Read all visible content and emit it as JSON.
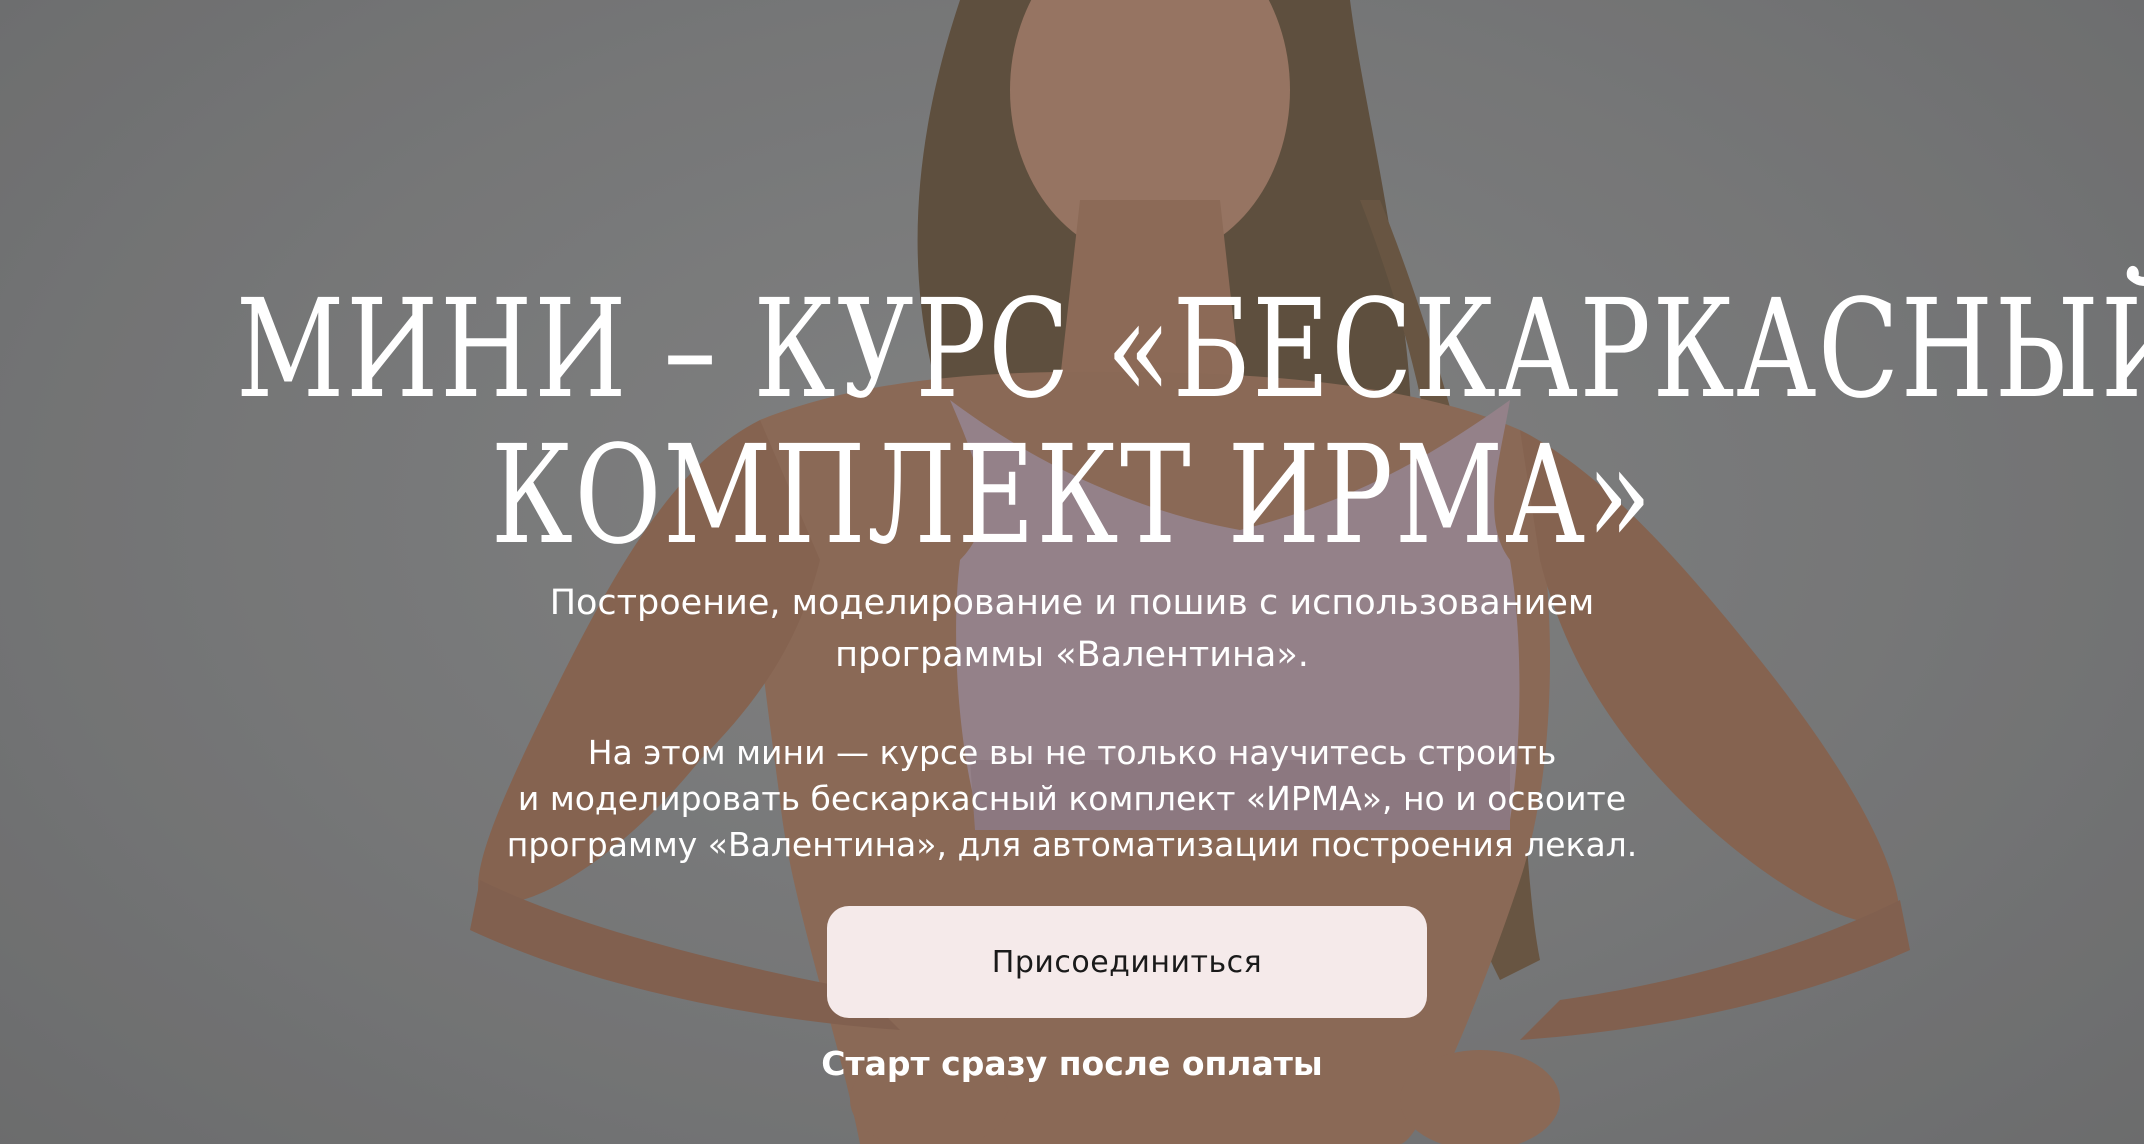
{
  "hero": {
    "title_line1": "МИНИ – КУРС «БЕСКАРКАСНЫЙ",
    "title_line2": "КОМПЛЕКТ ИРМА»",
    "subtitle_line1": "Построение, моделирование и пошив с использованием",
    "subtitle_line2": "программы «Валентина».",
    "description_line1": "На этом мини — курсе вы не только научитесь строить",
    "description_line2": "и моделировать бескаркасный комплект «ИРМА», но и освоите",
    "description_line3": "программу «Валентина», для автоматизации построения лекал.",
    "cta_label": "Присоединиться",
    "start_note": "Старт сразу после оплаты"
  },
  "colors": {
    "button_background": "#f5eaea",
    "button_text": "#1a1a1a",
    "text": "#ffffff",
    "overlay": "#8a8b8c"
  }
}
